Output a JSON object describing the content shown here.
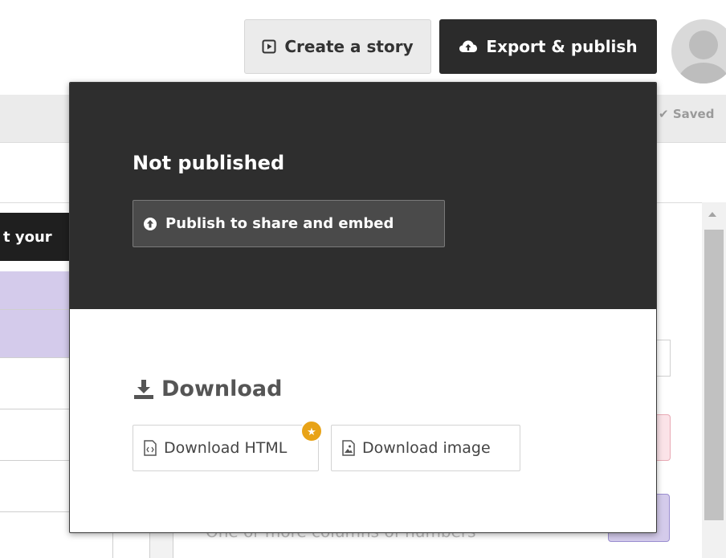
{
  "header": {
    "create_story_label": "Create a story",
    "export_publish_label": "Export & publish",
    "saved_label": "Saved"
  },
  "background": {
    "tab_text": "t your",
    "peek_text": "One or more columns of numbers"
  },
  "export_menu": {
    "status_title": "Not published",
    "publish_button_label": "Publish to share and embed",
    "download_heading": "Download",
    "download_html_label": "Download HTML",
    "download_image_label": "Download image"
  },
  "colors": {
    "dark_bar": "#2e2e2e",
    "export_button": "#2b2b2b",
    "badge_orange": "#e8a317",
    "purple_row": "#d4cbeb",
    "pink_box": "#fbe3e8"
  },
  "icons": {
    "create_story": "play-square-icon",
    "export": "cloud-upload-icon",
    "publish": "arrow-up-circle-icon",
    "download": "download-icon",
    "html_file": "code-file-icon",
    "image_file": "image-file-icon",
    "badge": "star-icon",
    "saved": "check-icon"
  }
}
